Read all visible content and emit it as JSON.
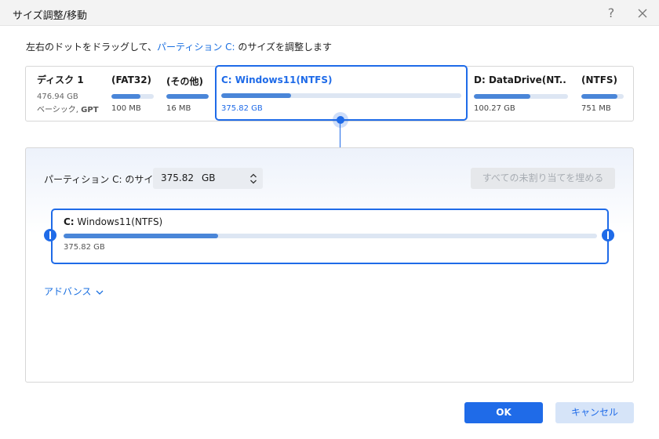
{
  "window": {
    "title": "サイズ調整/移動",
    "help": "?"
  },
  "instruction": {
    "before": "左右のドットをドラッグして、",
    "highlight": "パーティション C:",
    "after": " のサイズを調整します"
  },
  "disk": {
    "name": "ディスク 1",
    "size": "476.94 GB",
    "type_prefix": "ベーシック, ",
    "type_bold": "GPT"
  },
  "partitions": [
    {
      "label": "(FAT32)",
      "size": "100 MB",
      "used_fraction": 0.68,
      "selected": false
    },
    {
      "label": "(その他)",
      "size": "16 MB",
      "used_fraction": 1.0,
      "selected": false
    },
    {
      "label": "C: Windows11(NTFS)",
      "size": "375.82 GB",
      "used_fraction": 0.29,
      "selected": true
    },
    {
      "label": "D: DataDrive(NT...",
      "size": "100.27 GB",
      "used_fraction": 0.6,
      "selected": false
    },
    {
      "label": "(NTFS)",
      "size": "751 MB",
      "used_fraction": 0.85,
      "selected": false
    }
  ],
  "resize_panel": {
    "size_label": "パーティション C: のサイズ",
    "size_value": "375.82",
    "size_unit": "GB",
    "fill_button": "すべての未割り当てを埋める",
    "slider": {
      "label_drive": "C:",
      "label_name": " Windows11(NTFS)",
      "size": "375.82 GB",
      "used_fraction": 0.29
    },
    "advanced": "アドバンス"
  },
  "buttons": {
    "ok": "OK",
    "cancel": "キャンセル"
  },
  "colors": {
    "accent": "#1f6be8",
    "bar_fill": "#4a86d8",
    "bar_track": "#dde6f3"
  }
}
